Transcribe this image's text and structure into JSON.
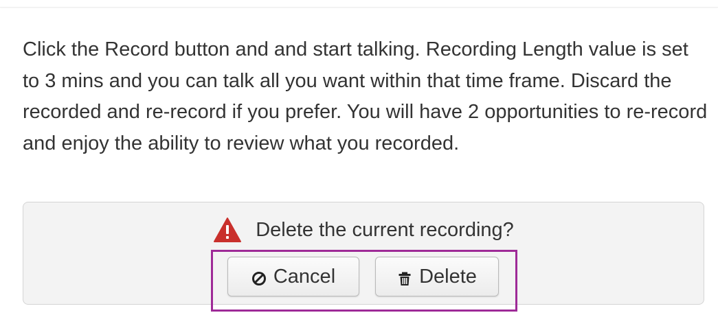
{
  "instructions": {
    "text": "Click the Record button and and start talking. Recording Length value is set to 3 mins and you can talk all you want within that time frame. Discard the recorded and re-record if you prefer. You will have 2 opportunities to re-record and enjoy the ability to review what you recorded."
  },
  "confirm": {
    "prompt": "Delete the current recording?",
    "warning_icon": "warning-triangle-icon",
    "warning_color": "#c9302c"
  },
  "buttons": {
    "cancel_label": "Cancel",
    "cancel_icon": "ban-icon",
    "delete_label": "Delete",
    "delete_icon": "trash-icon"
  },
  "colors": {
    "highlight": "#9e2a97",
    "panel_background": "#f3f3f3",
    "text": "#333333"
  }
}
